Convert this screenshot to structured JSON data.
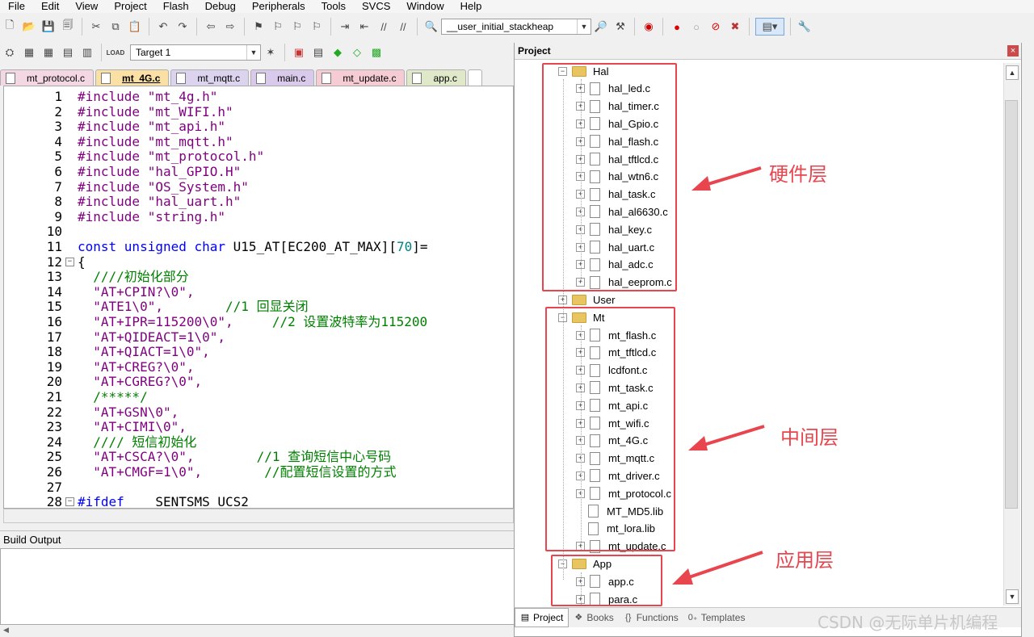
{
  "menu": [
    "File",
    "Edit",
    "View",
    "Project",
    "Flash",
    "Debug",
    "Peripherals",
    "Tools",
    "SVCS",
    "Window",
    "Help"
  ],
  "toolbar": {
    "stack_combo": "__user_initial_stackheap",
    "target_combo": "Target 1",
    "load_label": "LOAD"
  },
  "file_tabs": [
    {
      "label": "mt_protocol.c",
      "color": "#f3d7e2",
      "active": false
    },
    {
      "label": "mt_4G.c",
      "color": "#fbe0a6",
      "active": true
    },
    {
      "label": "mt_mqtt.c",
      "color": "#dcd3ef",
      "active": false
    },
    {
      "label": "main.c",
      "color": "#d9c9ea",
      "active": false
    },
    {
      "label": "mt_update.c",
      "color": "#f6ccd4",
      "active": false
    },
    {
      "label": "app.c",
      "color": "#dfe8c9",
      "active": false
    }
  ],
  "code": [
    {
      "n": "1",
      "t": [
        [
          "str",
          "#include \"mt_4g.h\""
        ]
      ]
    },
    {
      "n": "2",
      "t": [
        [
          "str",
          "#include \"mt_WIFI.h\""
        ]
      ]
    },
    {
      "n": "3",
      "t": [
        [
          "str",
          "#include \"mt_api.h\""
        ]
      ]
    },
    {
      "n": "4",
      "t": [
        [
          "str",
          "#include \"mt_mqtt.h\""
        ]
      ]
    },
    {
      "n": "5",
      "t": [
        [
          "str",
          "#include \"mt_protocol.h\""
        ]
      ]
    },
    {
      "n": "6",
      "t": [
        [
          "str",
          "#include \"hal_GPIO.H\""
        ]
      ]
    },
    {
      "n": "7",
      "t": [
        [
          "str",
          "#include \"OS_System.h\""
        ]
      ]
    },
    {
      "n": "8",
      "t": [
        [
          "str",
          "#include \"hal_uart.h\""
        ]
      ]
    },
    {
      "n": "9",
      "t": [
        [
          "str",
          "#include \"string.h\""
        ]
      ]
    },
    {
      "n": "10",
      "t": []
    },
    {
      "n": "11",
      "t": [
        [
          "kw",
          "const unsigned char"
        ],
        [
          "pl",
          " U15_AT[EC200_AT_MAX]["
        ],
        [
          "num",
          "70"
        ],
        [
          "pl",
          "]="
        ]
      ]
    },
    {
      "n": "12",
      "fold": true,
      "t": [
        [
          "pl",
          "{"
        ]
      ]
    },
    {
      "n": "13",
      "t": [
        [
          "cm",
          "  ////初始化部分"
        ]
      ]
    },
    {
      "n": "14",
      "t": [
        [
          "str",
          "  \"AT+CPIN?\\0\","
        ]
      ]
    },
    {
      "n": "15",
      "t": [
        [
          "str",
          "  \"ATE1\\0\",      "
        ],
        [
          "cm",
          "  //1 回显关闭"
        ]
      ]
    },
    {
      "n": "16",
      "t": [
        [
          "str",
          "  \"AT+IPR=115200\\0\",  "
        ],
        [
          "cm",
          "   //2 设置波特率为115200"
        ]
      ]
    },
    {
      "n": "17",
      "t": [
        [
          "str",
          "  \"AT+QIDEACT=1\\0\","
        ]
      ]
    },
    {
      "n": "18",
      "t": [
        [
          "str",
          "  \"AT+QIACT=1\\0\","
        ]
      ]
    },
    {
      "n": "19",
      "t": [
        [
          "str",
          "  \"AT+CREG?\\0\","
        ]
      ]
    },
    {
      "n": "20",
      "t": [
        [
          "str",
          "  \"AT+CGREG?\\0\","
        ]
      ]
    },
    {
      "n": "21",
      "t": [
        [
          "cm",
          "  /*****/"
        ]
      ]
    },
    {
      "n": "22",
      "t": [
        [
          "str",
          "  \"AT+GSN\\0\","
        ]
      ]
    },
    {
      "n": "23",
      "t": [
        [
          "str",
          "  \"AT+CIMI\\0\","
        ]
      ]
    },
    {
      "n": "24",
      "t": [
        [
          "cm",
          "  //// 短信初始化"
        ]
      ]
    },
    {
      "n": "25",
      "t": [
        [
          "str",
          "  \"AT+CSCA?\\0\",      "
        ],
        [
          "cm",
          "  //1 查询短信中心号码"
        ]
      ]
    },
    {
      "n": "26",
      "t": [
        [
          "str",
          "  \"AT+CMGF=1\\0\",      "
        ],
        [
          "cm",
          "  //配置短信设置的方式"
        ]
      ]
    },
    {
      "n": "27",
      "t": []
    },
    {
      "n": "28",
      "fold": true,
      "t": [
        [
          "kw",
          "#ifdef"
        ],
        [
          "pl",
          " ___SENTSMS_UCS2"
        ]
      ]
    }
  ],
  "build_output": {
    "title": "Build Output"
  },
  "project": {
    "title": "Project",
    "close": "×",
    "tree": [
      {
        "kind": "folder",
        "label": "Hal",
        "expanded": true
      },
      {
        "kind": "file",
        "label": "hal_led.c",
        "exp": true
      },
      {
        "kind": "file",
        "label": "hal_timer.c",
        "exp": true
      },
      {
        "kind": "file",
        "label": "hal_Gpio.c",
        "exp": true
      },
      {
        "kind": "file",
        "label": "hal_flash.c",
        "exp": true
      },
      {
        "kind": "file",
        "label": "hal_tftlcd.c",
        "exp": true
      },
      {
        "kind": "file",
        "label": "hal_wtn6.c",
        "exp": true
      },
      {
        "kind": "file",
        "label": "hal_task.c",
        "exp": true
      },
      {
        "kind": "file",
        "label": "hal_al6630.c",
        "exp": true
      },
      {
        "kind": "file",
        "label": "hal_key.c",
        "exp": true
      },
      {
        "kind": "file",
        "label": "hal_uart.c",
        "exp": true
      },
      {
        "kind": "file",
        "label": "hal_adc.c",
        "exp": true
      },
      {
        "kind": "file",
        "label": "hal_eeprom.c",
        "exp": true
      },
      {
        "kind": "folder",
        "label": "User",
        "expanded": false
      },
      {
        "kind": "folder",
        "label": "Mt",
        "expanded": true
      },
      {
        "kind": "file",
        "label": "mt_flash.c",
        "exp": true
      },
      {
        "kind": "file",
        "label": "mt_tftlcd.c",
        "exp": true
      },
      {
        "kind": "file",
        "label": "lcdfont.c",
        "exp": true
      },
      {
        "kind": "file",
        "label": "mt_task.c",
        "exp": true
      },
      {
        "kind": "file",
        "label": "mt_api.c",
        "exp": true
      },
      {
        "kind": "file",
        "label": "mt_wifi.c",
        "exp": true
      },
      {
        "kind": "file",
        "label": "mt_4G.c",
        "exp": true
      },
      {
        "kind": "file",
        "label": "mt_mqtt.c",
        "exp": true
      },
      {
        "kind": "file",
        "label": "mt_driver.c",
        "exp": true
      },
      {
        "kind": "file",
        "label": "mt_protocol.c",
        "exp": true
      },
      {
        "kind": "file",
        "label": "MT_MD5.lib",
        "exp": false
      },
      {
        "kind": "file",
        "label": "mt_lora.lib",
        "exp": false
      },
      {
        "kind": "file",
        "label": "mt_update.c",
        "exp": true
      },
      {
        "kind": "folder",
        "label": "App",
        "expanded": true
      },
      {
        "kind": "file",
        "label": "app.c",
        "exp": true
      },
      {
        "kind": "file",
        "label": "para.c",
        "exp": true
      }
    ],
    "annotations": {
      "hardware": "硬件层",
      "middle": "中间层",
      "app": "应用层"
    },
    "bottom_tabs": [
      {
        "label": "Project",
        "icon": "project-icon",
        "active": true
      },
      {
        "label": "Books",
        "icon": "books-icon",
        "active": false
      },
      {
        "label": "Functions",
        "icon": "functions-icon",
        "active": false
      },
      {
        "label": "Templates",
        "icon": "templates-icon",
        "active": false
      }
    ]
  },
  "accent": "#e8454e",
  "watermark": "CSDN @无际单片机编程"
}
